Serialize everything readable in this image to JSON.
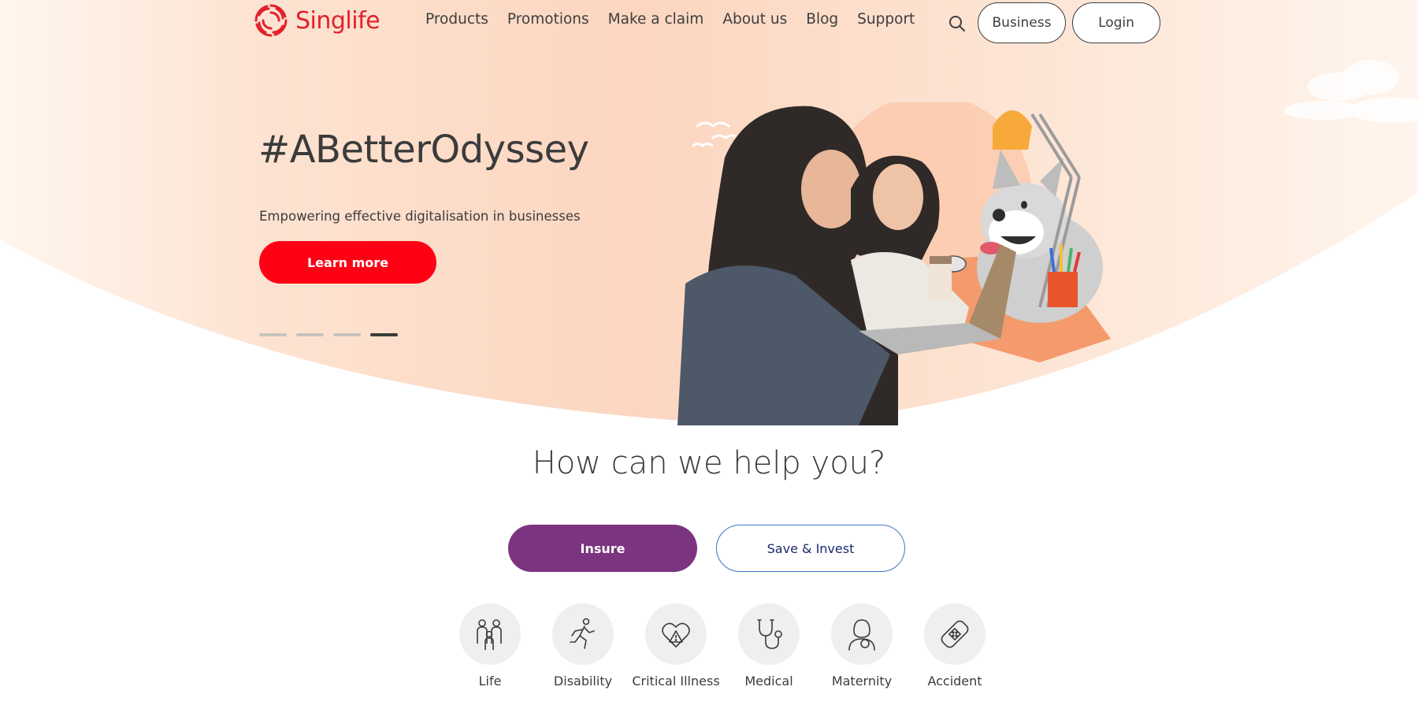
{
  "brand": {
    "name": "Singlife",
    "color": "#e3202b",
    "logo_icon": "spiral-logo-icon"
  },
  "nav": {
    "items": [
      {
        "label": "Products"
      },
      {
        "label": "Promotions"
      },
      {
        "label": "Make a claim"
      },
      {
        "label": "About us"
      },
      {
        "label": "Blog"
      },
      {
        "label": "Support"
      }
    ],
    "search_icon": "search-icon",
    "business_label": "Business",
    "login_label": "Login"
  },
  "hero": {
    "title": "#ABetterOdyssey",
    "subtitle": "Empowering effective digitalisation in businesses",
    "cta_label": "Learn more",
    "cta_color": "#ff0015",
    "slides_total": 4,
    "active_slide": 4,
    "background_color": "#fbd9c3"
  },
  "help": {
    "title": "How can we help you?",
    "insure_label": "Insure",
    "insure_color": "#7b3580",
    "save_label": "Save & Invest",
    "categories": [
      {
        "label": "Life",
        "icon": "family-icon"
      },
      {
        "label": "Disability",
        "icon": "running-person-icon"
      },
      {
        "label": "Critical Illness",
        "icon": "heart-warning-icon"
      },
      {
        "label": "Medical",
        "icon": "stethoscope-icon"
      },
      {
        "label": "Maternity",
        "icon": "mother-baby-icon"
      },
      {
        "label": "Accident",
        "icon": "bandage-icon"
      }
    ]
  }
}
